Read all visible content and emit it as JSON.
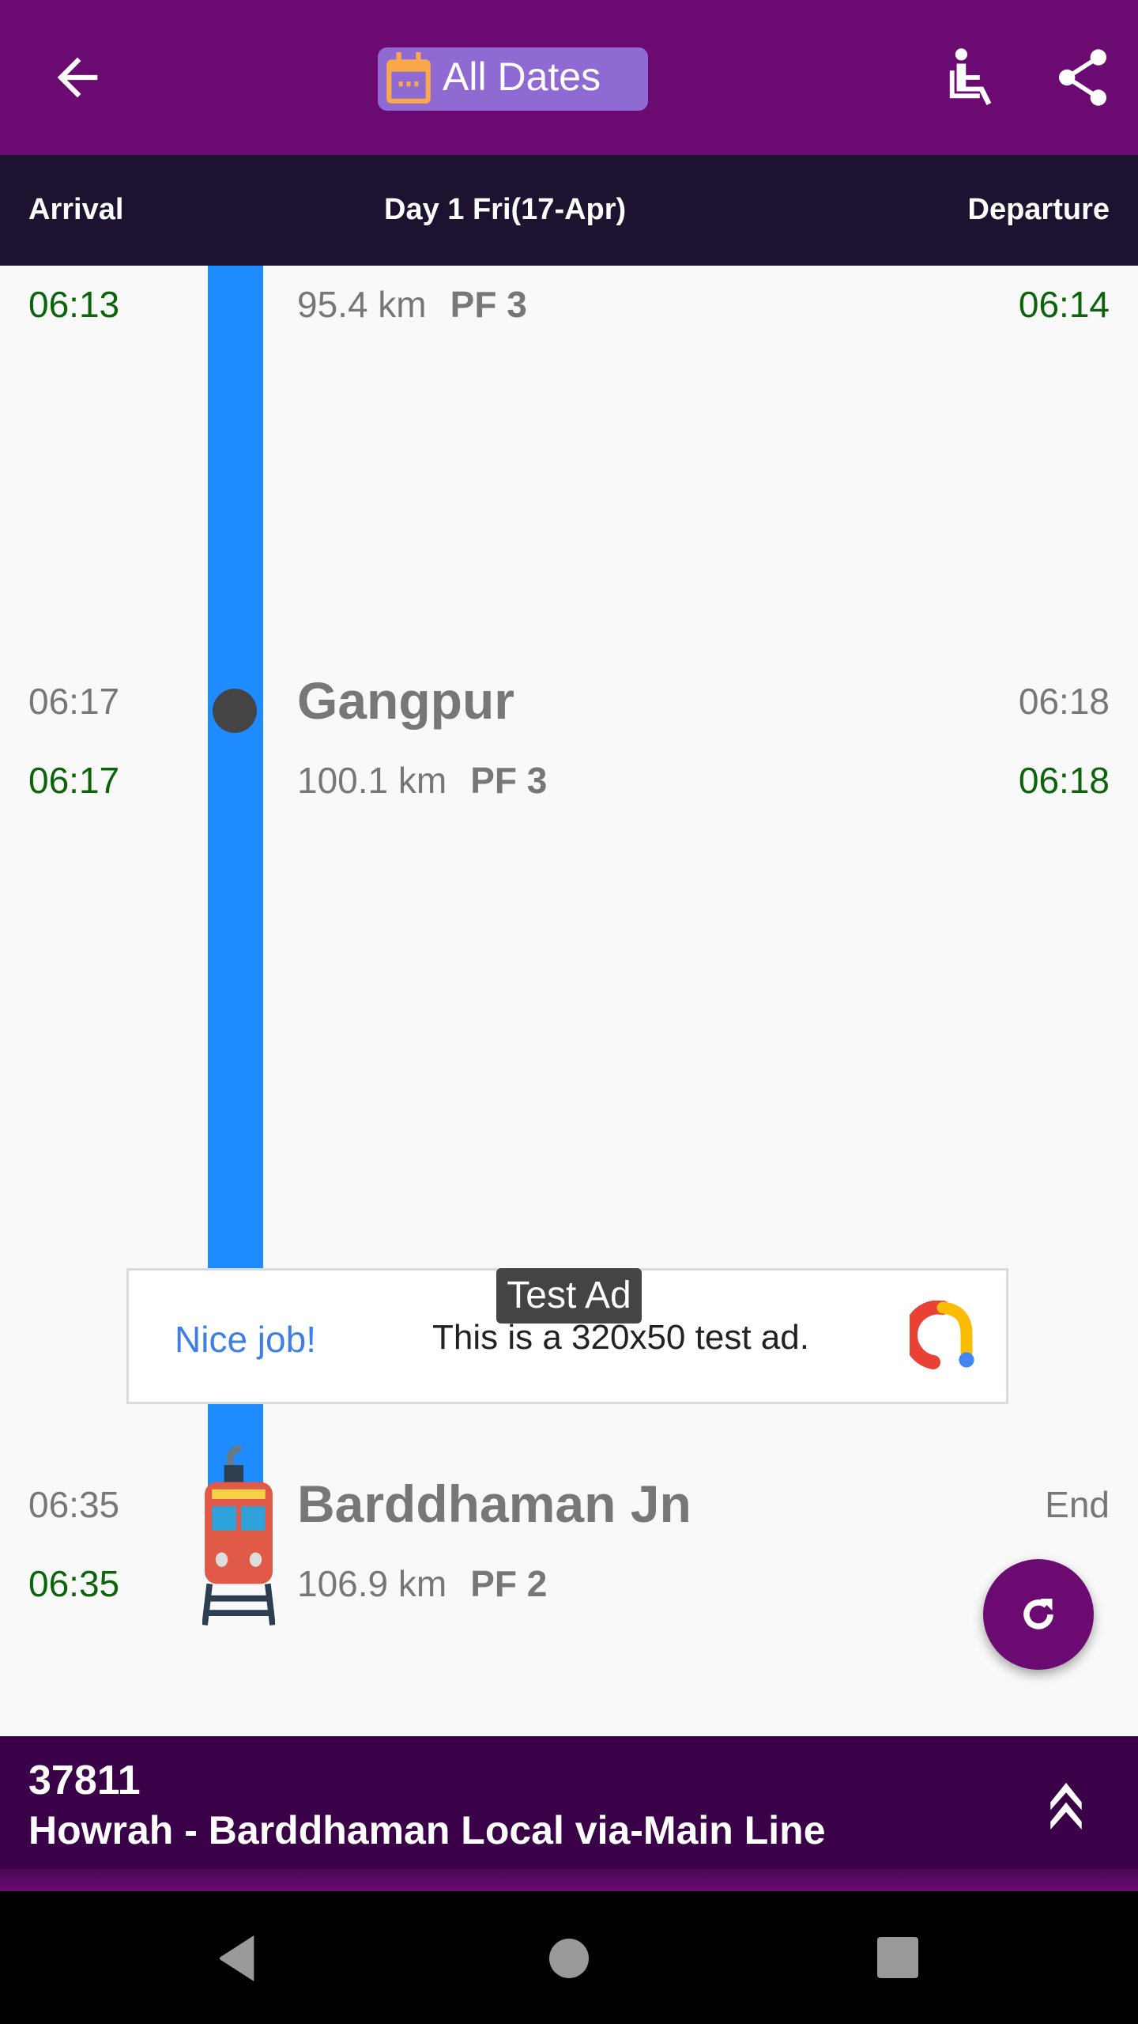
{
  "app_bar": {
    "back_icon": "arrow-left-icon",
    "date_filter_label": "All Dates",
    "date_filter_icon": "calendar-icon",
    "accessibility_icon": "wheelchair-icon",
    "share_icon": "share-icon"
  },
  "day_bar": {
    "arrival_label": "Arrival",
    "day_label": "Day 1 Fri(17-Apr)",
    "departure_label": "Departure"
  },
  "stations": [
    {
      "name": "",
      "sched_arrival": "",
      "actual_arrival": "06:13",
      "distance": "95.4 km",
      "platform": "PF 3",
      "sched_departure": "",
      "actual_departure": "06:14"
    },
    {
      "name": "Gangpur",
      "sched_arrival": "06:17",
      "actual_arrival": "06:17",
      "distance": "100.1 km",
      "platform": "PF 3",
      "sched_departure": "06:18",
      "actual_departure": "06:18"
    },
    {
      "name": "Barddhaman Jn",
      "sched_arrival": "06:35",
      "actual_arrival": "06:35",
      "distance": "106.9 km",
      "platform": "PF 2",
      "sched_departure": "End",
      "actual_departure": ""
    }
  ],
  "ad": {
    "badge": "Test Ad",
    "headline": "Nice job!",
    "body": "This is a 320x50 test ad.",
    "logo_icon": "ad-logo-icon"
  },
  "fab": {
    "icon": "refresh-icon"
  },
  "train": {
    "number": "37811",
    "name": "Howrah - Barddhaman Local via-Main Line",
    "expand_icon": "double-chevron-up-icon"
  },
  "colors": {
    "primary": "#6b0b71",
    "rail": "#1e8bff",
    "on_time": "#0b6409",
    "day_bar": "#1d1330",
    "bottom_bar": "#3a0048"
  }
}
